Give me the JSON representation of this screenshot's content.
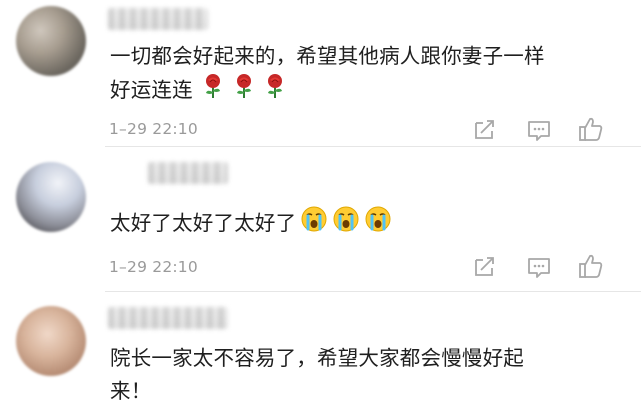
{
  "comments": [
    {
      "lines": [
        "一切都会好起来的，希望其他病人跟你妻子一样",
        "好运连连"
      ],
      "emoji": "rose-emoji",
      "emoji_count": 3,
      "time": "1–29 22:10"
    },
    {
      "lines": [
        "太好了太好了太好了"
      ],
      "emoji": "crying-face-emoji",
      "emoji_count": 3,
      "time": "1–29 22:10"
    },
    {
      "lines": [
        "院长一家太不容易了，希望大家都会慢慢好起",
        "来！"
      ]
    }
  ],
  "icons": {
    "share": "share-icon",
    "comment": "comment-icon",
    "like": "thumbs-up-icon"
  },
  "colors": {
    "text": "#1f1f1f",
    "meta": "#9a9a9a",
    "icon": "#a8a8a8",
    "divider": "#e6e6e6"
  }
}
